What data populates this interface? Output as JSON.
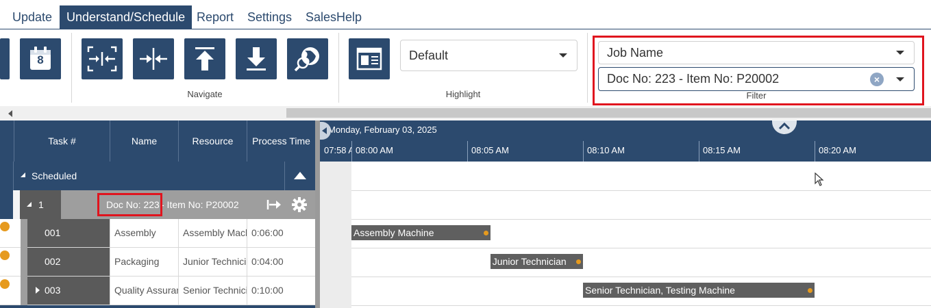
{
  "tabs": [
    "Update",
    "Understand/Schedule",
    "Report",
    "Settings",
    "SalesHelp"
  ],
  "ribbon": {
    "calendar_day": "8",
    "navigate_label": "Navigate",
    "highlight_label": "Highlight",
    "filter_label": "Filter",
    "highlight_value": "Default",
    "filter_field": "Job Name",
    "filter_value": "Doc No: 223 - Item No: P20002",
    "clear_symbol": "×"
  },
  "grid": {
    "columns": [
      "Task #",
      "Name",
      "Resource",
      "Process Time"
    ],
    "group_label": "Scheduled",
    "job": {
      "number": "1",
      "title_highlight": "Doc No: 223",
      "title_rest": " - Item No: P20002"
    },
    "tasks": [
      {
        "num": "001",
        "name": "Assembly",
        "resource": "Assembly Machine",
        "time": "0:06:00",
        "expandable": false
      },
      {
        "num": "002",
        "name": "Packaging",
        "resource": "Junior Technician",
        "time": "0:04:00",
        "expandable": false
      },
      {
        "num": "003",
        "name": "Quality Assurance",
        "resource": "Senior Technician, Testing Machine",
        "time": "0:10:00",
        "expandable": true
      }
    ]
  },
  "gantt": {
    "date": "Monday, February 03, 2025",
    "times": [
      "07:58 AM",
      "08:00 AM",
      "08:05 AM",
      "08:10 AM",
      "08:15 AM",
      "08:20 AM"
    ],
    "bars": [
      {
        "label": "Assembly Machine",
        "start_minute": 0,
        "duration_minutes": 6
      },
      {
        "label": "Junior Technician",
        "start_minute": 6,
        "duration_minutes": 4
      },
      {
        "label": "Senior Technician, Testing Machine",
        "start_minute": 10,
        "duration_minutes": 10
      }
    ]
  },
  "colors": {
    "navy": "#2c4a6e",
    "highlight_red": "#e0141e",
    "bar_gray": "#5f5f5f",
    "accent_orange": "#e69a1e"
  }
}
